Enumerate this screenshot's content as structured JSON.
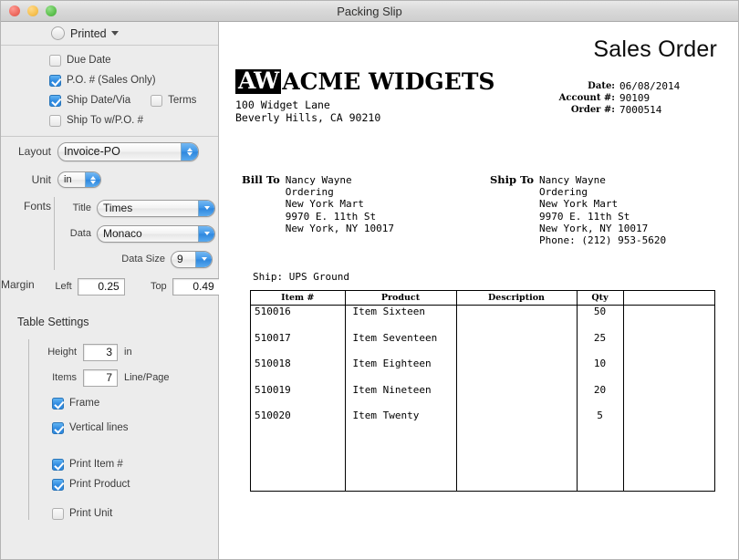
{
  "window": {
    "title": "Packing Slip",
    "traffic_lights": [
      "close",
      "minimize",
      "zoom"
    ]
  },
  "sidebar": {
    "print_mode": {
      "label": "Printed",
      "control": "radio-popup"
    },
    "options": [
      {
        "label": "Due Date",
        "checked": false
      },
      {
        "label": "P.O. # (Sales Only)",
        "checked": true
      },
      {
        "label": "Ship Date/Via",
        "checked": true
      },
      {
        "label": "Terms",
        "checked": false
      },
      {
        "label": "Ship To w/P.O. #",
        "checked": false
      }
    ],
    "layout": {
      "label": "Layout",
      "value": "Invoice-PO"
    },
    "unit": {
      "label": "Unit",
      "value": "in"
    },
    "fonts": {
      "group_label": "Fonts",
      "title": {
        "label": "Title",
        "value": "Times"
      },
      "data": {
        "label": "Data",
        "value": "Monaco"
      },
      "data_size": {
        "label": "Data Size",
        "value": "9"
      }
    },
    "margin": {
      "group_label": "Margin",
      "left": {
        "label": "Left",
        "value": "0.25"
      },
      "top": {
        "label": "Top",
        "value": "0.49"
      }
    },
    "table_settings": {
      "title": "Table Settings",
      "height": {
        "label": "Height",
        "value": "3",
        "unit": "in"
      },
      "items": {
        "label": "Items",
        "value": "7",
        "unit": "Line/Page"
      },
      "checkboxes": [
        {
          "label": "Frame",
          "checked": true
        },
        {
          "label": "Vertical lines",
          "checked": true
        },
        {
          "label": "Print Item #",
          "checked": true
        },
        {
          "label": "Print Product",
          "checked": true
        },
        {
          "label": "Print Unit",
          "checked": false
        }
      ]
    }
  },
  "document": {
    "doc_title": "Sales Order",
    "company": {
      "badge": "AW",
      "name": "ACME WIDGETS",
      "address": "100 Widget Lane\nBeverly Hills, CA 90210"
    },
    "meta": [
      {
        "key": "Date:",
        "value": "06/08/2014"
      },
      {
        "key": "Account #:",
        "value": "90109"
      },
      {
        "key": "Order #:",
        "value": "7000514"
      }
    ],
    "bill_to": {
      "heading": "Bill To",
      "lines": "Nancy Wayne\nOrdering\nNew York Mart\n9970 E. 11th St\nNew York, NY 10017"
    },
    "ship_to": {
      "heading": "Ship To",
      "lines": "Nancy Wayne\nOrdering\nNew York Mart\n9970 E. 11th St\nNew York, NY 10017\nPhone: (212) 953-5620"
    },
    "ship_via": "Ship: UPS Ground",
    "table": {
      "columns": [
        "Item #",
        "Product",
        "Description",
        "Qty",
        ""
      ],
      "rows": [
        {
          "item": "510016",
          "product": "Item Sixteen",
          "description": "",
          "qty": "50",
          "extra": ""
        },
        {
          "item": "510017",
          "product": "Item Seventeen",
          "description": "",
          "qty": "25",
          "extra": ""
        },
        {
          "item": "510018",
          "product": "Item Eighteen",
          "description": "",
          "qty": "10",
          "extra": ""
        },
        {
          "item": "510019",
          "product": "Item Nineteen",
          "description": "",
          "qty": "20",
          "extra": ""
        },
        {
          "item": "510020",
          "product": "Item Twenty",
          "description": "",
          "qty": "5",
          "extra": ""
        }
      ]
    }
  },
  "colors": {
    "accent_blue": "#2f8ae0",
    "sidebar_bg": "#ececec",
    "titlebar_bg": "#d8d8d8",
    "close_red": "#ed6a5f",
    "min_yellow": "#f6c150",
    "zoom_green": "#5ec14f"
  }
}
